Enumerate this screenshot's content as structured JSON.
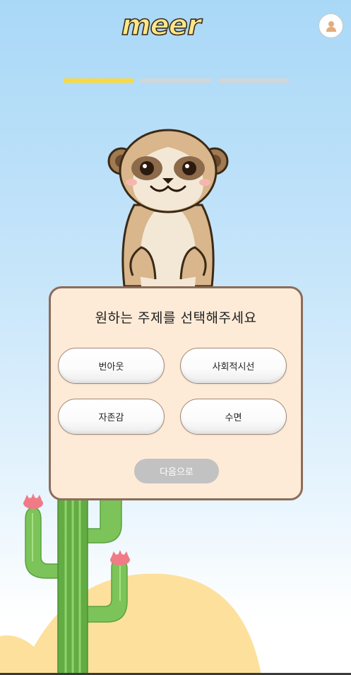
{
  "header": {
    "logo_text": "meer",
    "profile_icon": "user-icon"
  },
  "progress": {
    "current_step": 1,
    "total_steps": 3
  },
  "card": {
    "title": "원하는 주제를 선택해주세요",
    "topics": [
      {
        "label": "번아웃"
      },
      {
        "label": "사회적시선"
      },
      {
        "label": "자존감"
      },
      {
        "label": "수면"
      }
    ],
    "next_label": "다음으로"
  },
  "colors": {
    "progress_active": "#fbd93a",
    "progress_inactive": "#d2d6da",
    "card_background": "#fdebd8",
    "card_border": "#8c6c5a",
    "next_button_disabled": "#c2c2c2",
    "logo_fill": "#fde78a"
  }
}
